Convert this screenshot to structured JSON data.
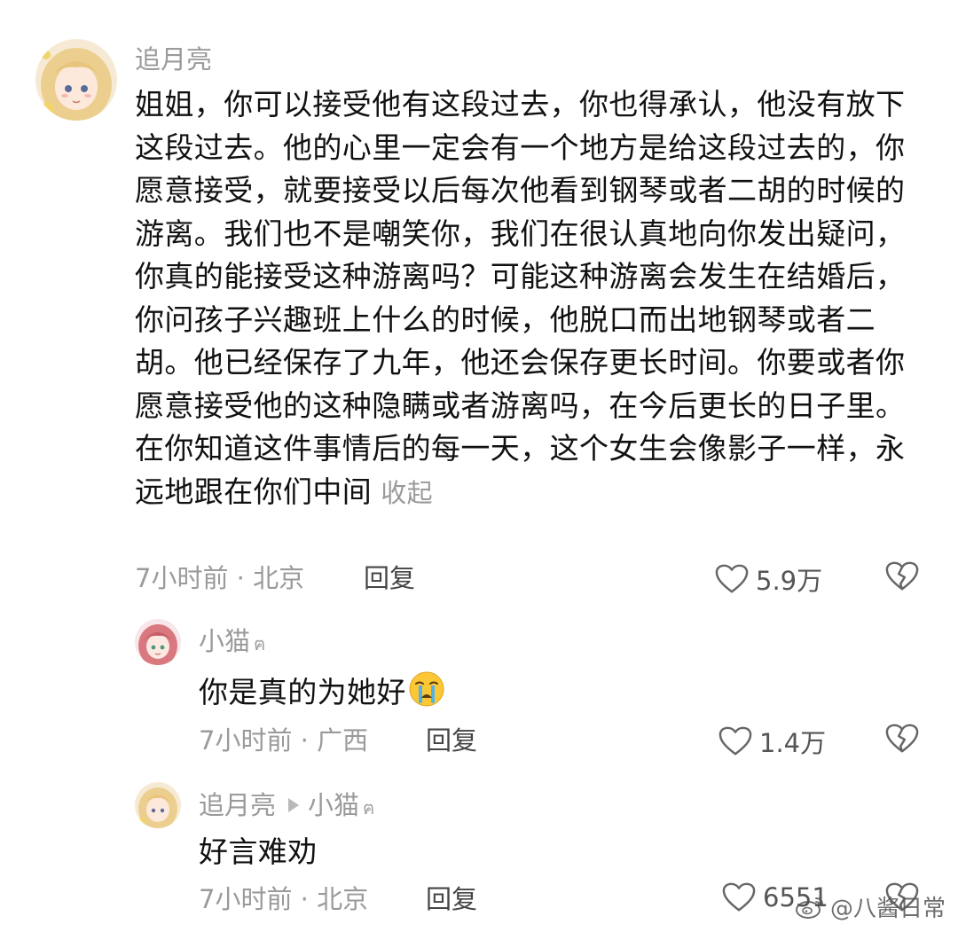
{
  "comments": [
    {
      "username": "追月亮",
      "text": "姐姐，你可以接受他有这段过去，你也得承认，他没有放下这段过去。他的心里一定会有一个地方是给这段过去的，你愿意接受，就要接受以后每次他看到钢琴或者二胡的时候的游离。我们也不是嘲笑你，我们在很认真地向你发出疑问，你真的能接受这种游离吗？可能这种游离会发生在结婚后，你问孩子兴趣班上什么的时候，他脱口而出地钢琴或者二胡。他已经保存了九年，他还会保存更长时间。你要或者你愿意接受他的这种隐瞒或者游离吗，在今后更长的日子里。在你知道这件事情后的每一天，这个女生会像影子一样，永远地跟在你们中间",
      "collapse_label": "收起",
      "meta": "7小时前 · 北京",
      "reply_label": "回复",
      "likes": "5.9万"
    },
    {
      "username": "小猫",
      "author_mark": "ฅ",
      "text": "你是真的为她好",
      "emoji": "crying-face",
      "meta": "7小时前 · 广西",
      "reply_label": "回复",
      "likes": "1.4万"
    },
    {
      "username": "追月亮",
      "reply_to": "小猫",
      "author_mark": "ฅ",
      "text": "好言难劝",
      "meta": "7小时前 · 北京",
      "reply_label": "回复",
      "likes": "6551"
    }
  ],
  "watermark": "@八酱日常",
  "icons": {
    "like": "heart-outline-icon",
    "dislike": "broken-heart-icon",
    "weibo": "weibo-logo"
  },
  "colors": {
    "text_primary": "#111111",
    "text_secondary": "#9a9a9a",
    "reply": "#444444",
    "background": "#ffffff"
  }
}
